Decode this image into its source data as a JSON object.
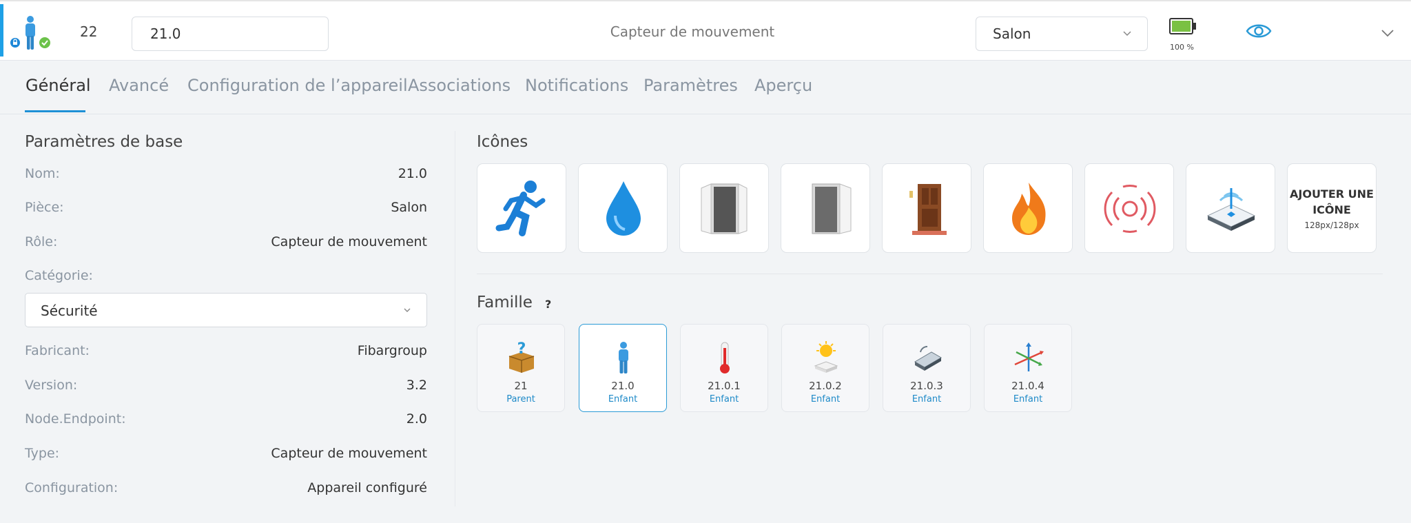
{
  "header": {
    "node_id": "22",
    "name_value": "21.0",
    "role": "Capteur de mouvement",
    "room": "Salon",
    "battery": "100 %",
    "battery_level": 1.0
  },
  "tabs": [
    {
      "label": "Général",
      "active": true
    },
    {
      "label": "Avancé"
    },
    {
      "label": "Configuration de l’appareil"
    },
    {
      "label": "Associations"
    },
    {
      "label": "Notifications"
    },
    {
      "label": "Paramètres"
    },
    {
      "label": "Aperçu"
    }
  ],
  "basic": {
    "title": "Paramètres de base",
    "rows": [
      {
        "label": "Nom:",
        "value": "21.0"
      },
      {
        "label": "Pièce:",
        "value": "Salon"
      },
      {
        "label": "Rôle:",
        "value": "Capteur de mouvement"
      }
    ],
    "category_label": "Catégorie:",
    "category_value": "Sécurité",
    "rows2": [
      {
        "label": "Fabricant:",
        "value": "Fibargroup"
      },
      {
        "label": "Version:",
        "value": "3.2"
      },
      {
        "label": "Node.Endpoint:",
        "value": "2.0"
      },
      {
        "label": "Type:",
        "value": "Capteur de mouvement"
      },
      {
        "label": "Configuration:",
        "value": "Appareil configuré"
      }
    ]
  },
  "icons": {
    "title": "Icônes",
    "items": [
      "running-person-icon",
      "water-drop-icon",
      "open-door-icon",
      "open-door-right-icon",
      "wooden-door-icon",
      "fire-icon",
      "alarm-signal-icon",
      "motion-sensor-device-icon"
    ],
    "add_label": "AJOUTER UNE ICÔNE",
    "add_size": "128px/128px"
  },
  "family": {
    "title": "Famille",
    "help": "?",
    "items": [
      {
        "id": "21",
        "role": "Parent",
        "icon": "question-box-icon"
      },
      {
        "id": "21.0",
        "role": "Enfant",
        "icon": "person-icon",
        "selected": true
      },
      {
        "id": "21.0.1",
        "role": "Enfant",
        "icon": "thermometer-icon"
      },
      {
        "id": "21.0.2",
        "role": "Enfant",
        "icon": "sun-light-icon"
      },
      {
        "id": "21.0.3",
        "role": "Enfant",
        "icon": "vibration-sensor-icon"
      },
      {
        "id": "21.0.4",
        "role": "Enfant",
        "icon": "axis-arrows-icon"
      }
    ]
  },
  "colors": {
    "accent": "#1e90d6",
    "battery": "#7ac143",
    "ok": "#6cc24a"
  }
}
